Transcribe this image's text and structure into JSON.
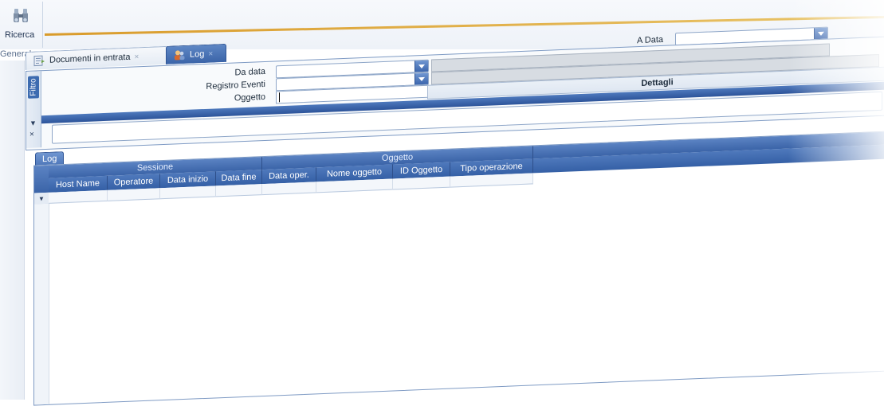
{
  "ribbon": {
    "search_button_label": "Ricerca",
    "group_label": "Generale",
    "search_icon": "binoculars-icon"
  },
  "tabs": [
    {
      "label": "Documenti in entrata",
      "close": "×",
      "icon": "document-icon",
      "active": false
    },
    {
      "label": "Log",
      "close": "×",
      "icon": "users-icon",
      "active": true
    }
  ],
  "filter": {
    "vtab_label": "Filtro",
    "pin_icon": "▼",
    "close_icon": "×",
    "a_data_label": "A Data",
    "da_data_label": "Da data",
    "registro_eventi_label": "Registro Eventi",
    "oggetto_label": "Oggetto",
    "dettagli_label": "Dettagli"
  },
  "grid": {
    "tab_label": "Log",
    "group_headers": {
      "sessione": "Sessione",
      "oggetto": "Oggetto"
    },
    "columns": [
      "Host Name",
      "Operatore",
      "Data inizio",
      "Data fine",
      "Data oper.",
      "Nome oggetto",
      "ID Oggetto",
      "Tipo operazione"
    ],
    "filter_row_icon": "▼",
    "rows": []
  },
  "colors": {
    "accent": "#3b64a8",
    "ribbon_underline": "#d99b2a"
  }
}
